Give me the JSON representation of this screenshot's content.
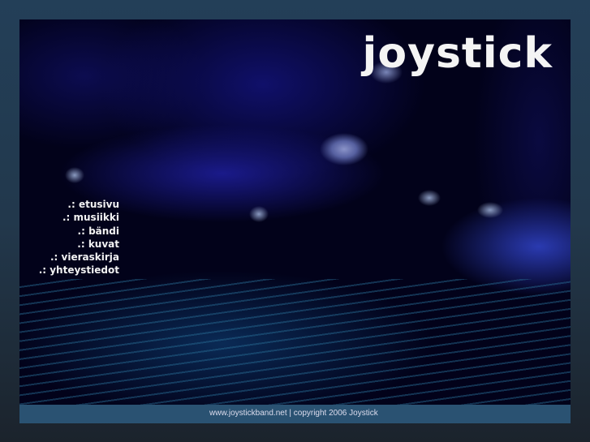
{
  "logo": "joystick",
  "nav": [
    ".: etusivu",
    ".: musiikki",
    ".: bändi",
    ".: kuvat",
    ".: vieraskirja",
    ".: yhteystiedot"
  ],
  "footer": "www.joystickband.net | copyright 2006 Joystick"
}
